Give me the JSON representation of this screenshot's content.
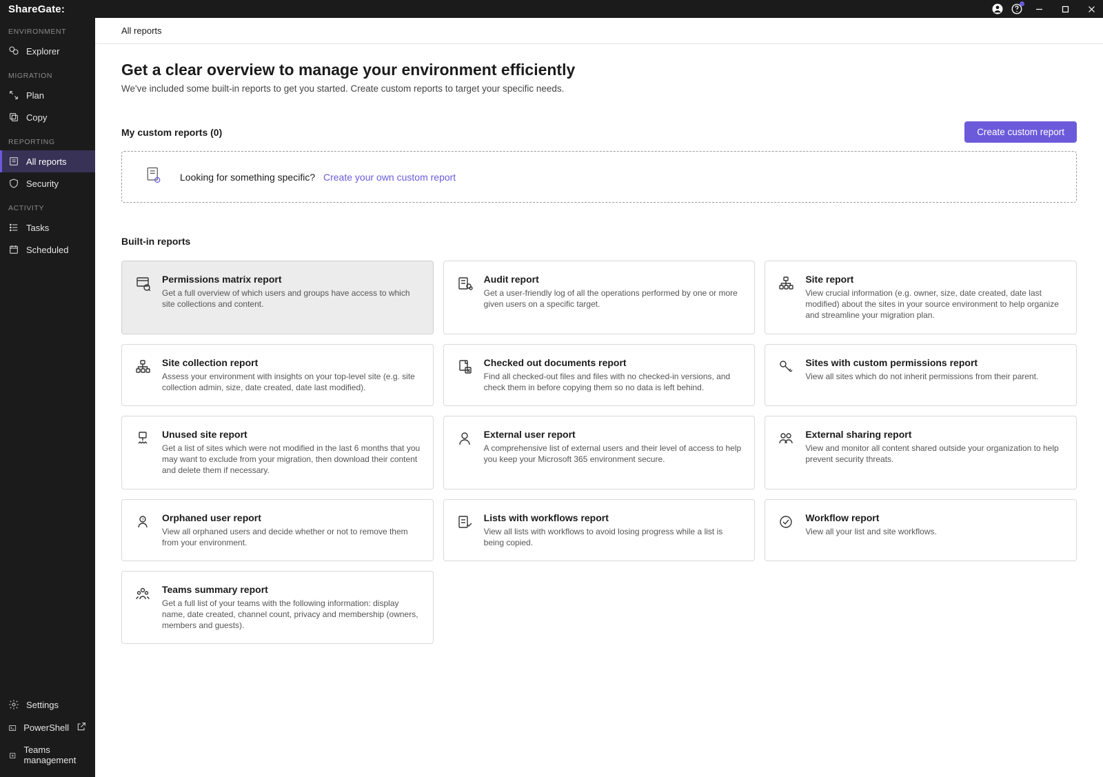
{
  "app_name": "ShareGate:",
  "breadcrumb": "All reports",
  "sidebar": {
    "sections": [
      {
        "label": "ENVIRONMENT",
        "items": [
          {
            "id": "explorer",
            "label": "Explorer"
          }
        ]
      },
      {
        "label": "MIGRATION",
        "items": [
          {
            "id": "plan",
            "label": "Plan"
          },
          {
            "id": "copy",
            "label": "Copy"
          }
        ]
      },
      {
        "label": "REPORTING",
        "items": [
          {
            "id": "allreports",
            "label": "All reports",
            "active": true
          },
          {
            "id": "security",
            "label": "Security"
          }
        ]
      },
      {
        "label": "ACTIVITY",
        "items": [
          {
            "id": "tasks",
            "label": "Tasks"
          },
          {
            "id": "scheduled",
            "label": "Scheduled"
          }
        ]
      }
    ],
    "footer": [
      {
        "id": "settings",
        "label": "Settings"
      },
      {
        "id": "powershell",
        "label": "PowerShell",
        "external": true
      },
      {
        "id": "teamsmgmt",
        "label": "Teams management"
      }
    ]
  },
  "page": {
    "title": "Get a clear overview to manage your environment efficiently",
    "subtitle": "We've included some built-in reports to get you started. Create custom reports to target your specific needs."
  },
  "custom_reports": {
    "heading": "My custom reports (0)",
    "create_button": "Create custom report",
    "prompt_text": "Looking for something specific?",
    "prompt_link": "Create your own custom report"
  },
  "builtin": {
    "heading": "Built-in reports",
    "cards": [
      {
        "icon": "permissions",
        "title": "Permissions matrix report",
        "desc": "Get a full overview of which users and groups have access to which site collections and content.",
        "highlight": true
      },
      {
        "icon": "audit",
        "title": "Audit report",
        "desc": "Get a user-friendly log of all the operations performed by one or more given users on a specific target."
      },
      {
        "icon": "site",
        "title": "Site report",
        "desc": "View crucial information (e.g. owner, size, date created, date last modified) about the sites in your source environment to help organize and streamline your migration plan."
      },
      {
        "icon": "site",
        "title": "Site collection report",
        "desc": "Assess your environment with insights on your top-level site (e.g. site collection admin, size, date created, date last modified)."
      },
      {
        "icon": "checkedout",
        "title": "Checked out documents report",
        "desc": "Find all checked-out files and files with no checked-in versions, and check them in before copying them so no data is left behind."
      },
      {
        "icon": "key",
        "title": "Sites with custom permissions report",
        "desc": "View all sites which do not inherit permissions from their parent."
      },
      {
        "icon": "unused",
        "title": "Unused site report",
        "desc": "Get a list of sites which were not modified in the last 6 months that you may want to exclude from your migration, then download their content and delete them if necessary."
      },
      {
        "icon": "user",
        "title": "External user report",
        "desc": "A comprehensive list of external users and their level of access to help you keep your Microsoft 365 environment secure."
      },
      {
        "icon": "users",
        "title": "External sharing report",
        "desc": "View and monitor all content shared outside your organization to help prevent security threats."
      },
      {
        "icon": "orphan",
        "title": "Orphaned user report",
        "desc": "View all orphaned users and decide whether or not to remove them from your environment."
      },
      {
        "icon": "listwf",
        "title": "Lists with workflows report",
        "desc": "View all lists with workflows to avoid losing progress while a list is being copied."
      },
      {
        "icon": "workflow",
        "title": "Workflow report",
        "desc": "View all your list and site workflows."
      },
      {
        "icon": "teams",
        "title": "Teams summary report",
        "desc": "Get a full list of your teams with the following information: display name, date created, channel count, privacy and membership (owners, members and guests)."
      }
    ]
  }
}
